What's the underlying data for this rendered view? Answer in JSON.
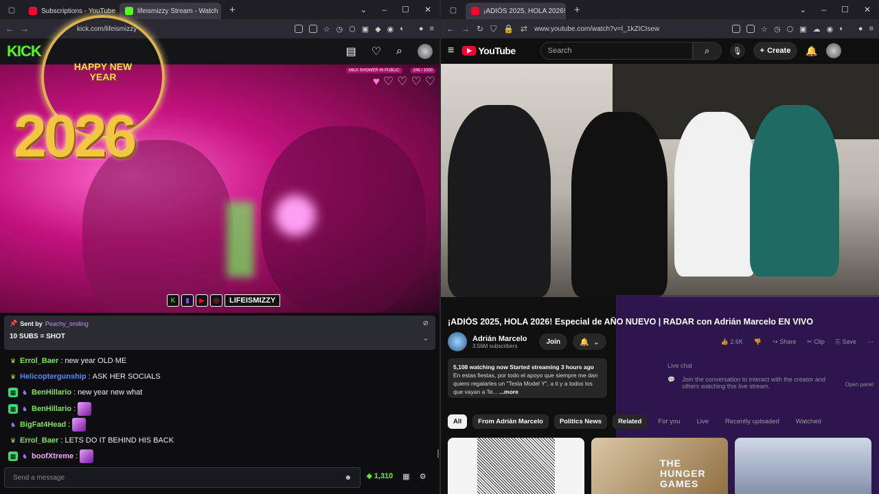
{
  "left_window": {
    "tabs": [
      {
        "title": "Subscriptions - YouTube",
        "favicon_color": "#ff0033"
      },
      {
        "title": "lifeismizzy Stream - Watch",
        "favicon_color": "#53fc18"
      }
    ],
    "url": "kick.com/lifeismizzy",
    "kick": {
      "logo": "KICK",
      "overlay": {
        "clock_text": "HAPPY NEW YEAR",
        "year": "2026"
      },
      "milk_label": "MILK SHOWER IN PUBLIC",
      "milk_progress": "245 / 1000",
      "social_handle": "LIFEISMIZZY",
      "pinned": {
        "sent_by_label": "Sent by",
        "sender": "Peachy_smiling",
        "message": "10 SUBS = SHOT"
      },
      "chat": [
        {
          "badges": [
            "crown"
          ],
          "user": "Errol_Baer",
          "color": "#7ee35a",
          "text": "new year OLD ME",
          "emote": false
        },
        {
          "badges": [
            "crown"
          ],
          "user": "Helicoptergunship",
          "color": "#4a8cff",
          "text": "ASK HER SOCIALS",
          "emote": false
        },
        {
          "badges": [
            "gift",
            "sub"
          ],
          "user": "BenHillario",
          "color": "#7ee35a",
          "text": "new year new what",
          "emote": false
        },
        {
          "badges": [
            "gift",
            "sub"
          ],
          "user": "BenHillario",
          "color": "#7ee35a",
          "text": "",
          "emote": true
        },
        {
          "badges": [
            "sub"
          ],
          "user": "BigFat4Head",
          "color": "#7ee35a",
          "text": "",
          "emote": true
        },
        {
          "badges": [
            "crown"
          ],
          "user": "Errol_Baer",
          "color": "#7ee35a",
          "text": "LETS DO IT BEHIND HIS BACK",
          "emote": false
        },
        {
          "badges": [
            "gift",
            "sub"
          ],
          "user": "boofXtreme",
          "color": "#f2a7ff",
          "text": "",
          "emote": true
        }
      ],
      "input_placeholder": "Send a message",
      "viewer_count": "1,310"
    }
  },
  "right_window": {
    "tabs": [
      {
        "title": "¡ADIÓS 2025, HOLA 2026! E",
        "favicon_color": "#ff0033"
      }
    ],
    "url": "www.youtube.com/watch?v=I_1kZICIsew",
    "youtube": {
      "logo": "YouTube",
      "search_placeholder": "Search",
      "create_label": "Create",
      "video_title": "¡ADIÓS 2025, HOLA 2026! Especial de AÑO NUEVO | RADAR con Adrián Marcelo EN VIVO",
      "channel": "Adrián Marcelo",
      "subscribers": "3.56M subscribers",
      "join_label": "Join",
      "likes": "2.6K",
      "share_label": "Share",
      "clip_label": "Clip",
      "save_label": "Save",
      "description_stats": "5,108 watching now  Started streaming 3 hours ago",
      "description_text": "En estas fiestas, por todo el apoyo que siempre me dan quiero regalarles un \"Tesla Model Y\", a ti y a todos los que vayan a Te...",
      "more_label": "...more",
      "live_chat_label": "Live chat",
      "live_chat_text": "Join the conversation to interact with the creator and others watching this live stream.",
      "open_panel_label": "Open panel",
      "chips": [
        "All",
        "From Adrián Marcelo",
        "Politics News",
        "Related",
        "For you",
        "Live",
        "Recently uploaded",
        "Watched"
      ],
      "thumb_text": "THE HUNGER GAMES"
    }
  }
}
